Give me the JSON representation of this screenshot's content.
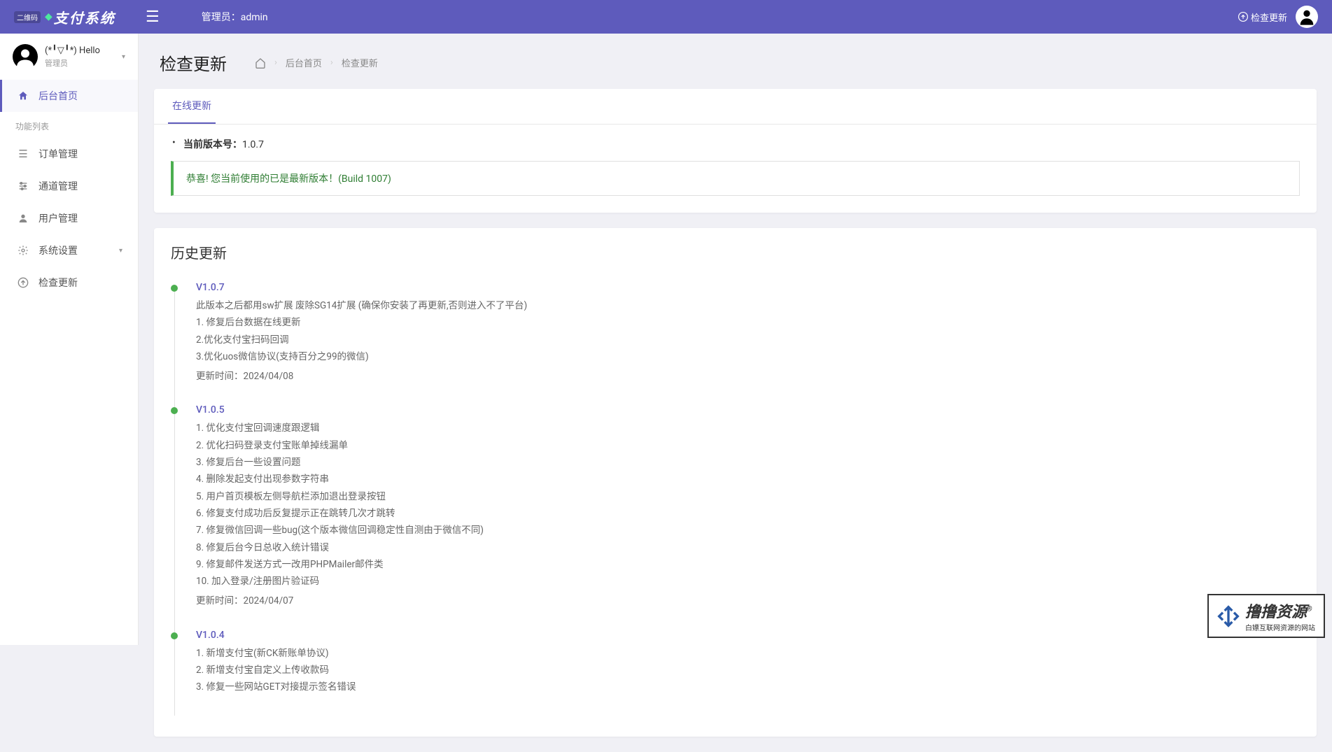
{
  "header": {
    "logo_badge": "二维码",
    "logo_text": "支付系统",
    "admin_label": "管理员：admin",
    "check_update": "检查更新"
  },
  "sidebar": {
    "user": {
      "hello": "(*╹▽╹*) Hello",
      "role": "管理员"
    },
    "home_label": "后台首页",
    "section_label": "功能列表",
    "items": [
      {
        "label": "订单管理",
        "icon": "☰"
      },
      {
        "label": "通道管理",
        "icon": "⚙"
      },
      {
        "label": "用户管理",
        "icon": "👤"
      },
      {
        "label": "系统设置",
        "icon": "⚙",
        "expandable": true
      },
      {
        "label": "检查更新",
        "icon": "⬆"
      }
    ]
  },
  "page": {
    "title": "检查更新",
    "breadcrumb": {
      "home": "后台首页",
      "current": "检查更新"
    }
  },
  "update_card": {
    "tab_label": "在线更新",
    "version_label": "当前版本号：",
    "version_value": "1.0.7",
    "alert": "恭喜! 您当前使用的已是最新版本！(Build 1007)"
  },
  "history": {
    "title": "历史更新",
    "items": [
      {
        "version": "V1.0.7",
        "lines": [
          "此版本之后都用sw扩展 废除SG14扩展 (确保你安装了再更新,否则进入不了平台)",
          "1. 修复后台数据在线更新",
          "2.优化支付宝扫码回调",
          "3.优化uos微信协议(支持百分之99的微信)"
        ],
        "time": "更新时间：2024/04/08"
      },
      {
        "version": "V1.0.5",
        "lines": [
          "1. 优化支付宝回调速度跟逻辑",
          "2. 优化扫码登录支付宝账单掉线漏单",
          "3. 修复后台一些设置问题",
          "4. 删除发起支付出现参数字符串",
          "5. 用户首页模板左侧导航栏添加退出登录按钮",
          "6. 修复支付成功后反复提示正在跳转几次才跳转",
          "7. 修复微信回调一些bug(这个版本微信回调稳定性自测由于微信不同)",
          "8. 修复后台今日总收入统计错误",
          "9. 修复邮件发送方式一改用PHPMailer邮件类",
          "10. 加入登录/注册图片验证码"
        ],
        "time": "更新时间：2024/04/07"
      },
      {
        "version": "V1.0.4",
        "lines": [
          "1. 新增支付宝(新CK新账单协议)",
          "2. 新增支付宝自定义上传收款码",
          "3. 修复一些网站GET对接提示签名错误"
        ],
        "time": ""
      }
    ]
  },
  "watermark": {
    "main": "撸撸资源",
    "sub": "白嫖互联网资源的网站"
  }
}
